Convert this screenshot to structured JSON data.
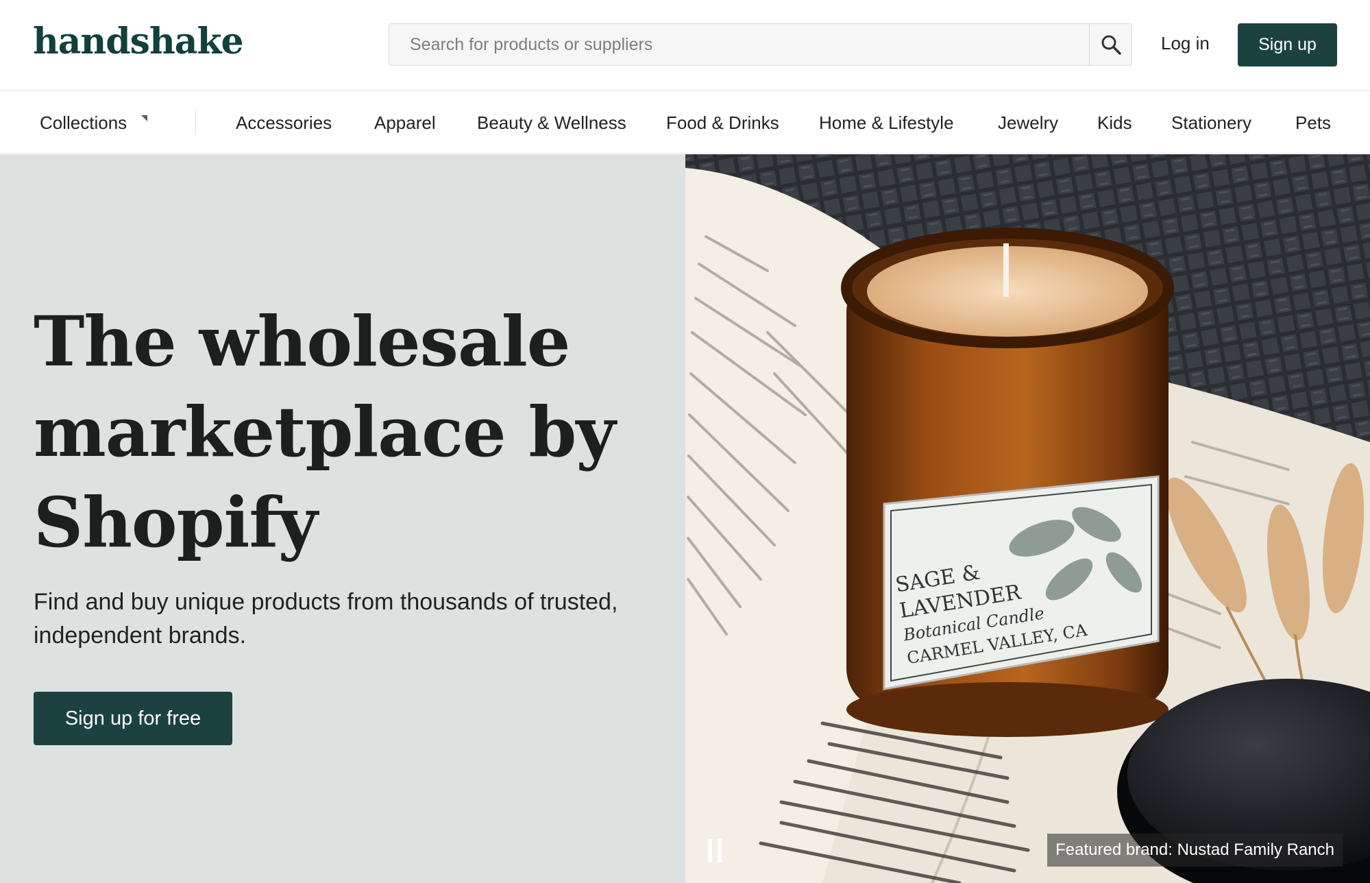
{
  "header": {
    "logo": "handshake",
    "search_placeholder": "Search for products or suppliers",
    "login_label": "Log in",
    "signup_label": "Sign up"
  },
  "nav": {
    "collections_label": "Collections",
    "items": [
      "Accessories",
      "Apparel",
      "Beauty & Wellness",
      "Food & Drinks",
      "Home & Lifestyle",
      "Jewelry",
      "Kids",
      "Stationery",
      "Pets"
    ]
  },
  "hero": {
    "title": "The wholesale marketplace by Shopify",
    "subtitle": "Find and buy unique products from thousands of trusted, independent brands.",
    "cta_label": "Sign up for free",
    "featured_caption": "Featured brand: Nustad Family Ranch",
    "candle_label": {
      "line1": "SAGE &",
      "line2": "LAVENDER",
      "line3": "Botanical Candle",
      "line4": "CARMEL VALLEY, CA"
    }
  },
  "colors": {
    "brand": "#12403c",
    "button": "#1b4240",
    "hero_bg": "#dde2e0"
  }
}
